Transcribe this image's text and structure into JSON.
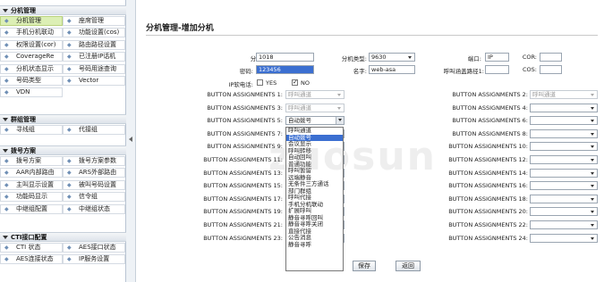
{
  "sidebar": {
    "sections": [
      {
        "title": "分机管理",
        "items": [
          {
            "label": "分机管理",
            "active": true
          },
          {
            "label": "座席管理",
            "active": false
          },
          {
            "label": "手机分机联动",
            "active": false
          },
          {
            "label": "功能设置(cos)",
            "active": false
          },
          {
            "label": "权限设置(cor)",
            "active": false
          },
          {
            "label": "路由路径设置",
            "active": false
          },
          {
            "label": "CoverageRe",
            "active": false
          },
          {
            "label": "已注册IP话机",
            "active": false
          },
          {
            "label": "分机状态显示",
            "active": false
          },
          {
            "label": "号码用途查询",
            "active": false
          },
          {
            "label": "号码类型",
            "active": false
          },
          {
            "label": "Vector",
            "active": false
          },
          {
            "label": "VDN",
            "active": false
          }
        ]
      },
      {
        "title": "群组管理",
        "items": [
          {
            "label": "寻线组",
            "active": false
          },
          {
            "label": "代接组",
            "active": false
          }
        ]
      },
      {
        "title": "拨号方案",
        "items": [
          {
            "label": "拨号方案",
            "active": false
          },
          {
            "label": "拨号方案参数",
            "active": false
          },
          {
            "label": "AAR内部路由",
            "active": false
          },
          {
            "label": "ARS外部路由",
            "active": false
          },
          {
            "label": "主叫显示设置",
            "active": false
          },
          {
            "label": "被叫号码设置",
            "active": false
          },
          {
            "label": "功能码显示",
            "active": false
          },
          {
            "label": "信令组",
            "active": false
          },
          {
            "label": "中继组配置",
            "active": false
          },
          {
            "label": "中继组状态",
            "active": false
          }
        ]
      },
      {
        "title": "CTI接口配置",
        "items": [
          {
            "label": "CTI 状态",
            "active": false
          },
          {
            "label": "AES接口状态",
            "active": false
          },
          {
            "label": "AES连接状态",
            "active": false
          },
          {
            "label": "IP服务设置",
            "active": false
          }
        ]
      }
    ]
  },
  "page": {
    "title": "分机管理-增加分机"
  },
  "form": {
    "ext_no_label": "分机号码:",
    "ext_no_value": "1018",
    "ext_type_label": "分机类型:",
    "ext_type_value": "9630",
    "port_label": "端口:",
    "port_value": "IP",
    "cor_label": "COR:",
    "cor_value": "",
    "password_label": "密码:",
    "password_value": "123456",
    "name_label": "名字:",
    "name_value": "web-asa",
    "cover_path_label": "呼叫涵盖路径1:",
    "cover_path_value": "",
    "cos_label": "COS:",
    "cos_value": "",
    "ip_softphone_label": "IP软电话:",
    "ip_yes_label": "YES",
    "ip_no_label": "NO",
    "ip_yes_checked": false,
    "ip_no_checked": true
  },
  "button_assignments": {
    "left": [
      {
        "label": "BUTTON ASSIGNMENTS 1:",
        "value": "呼叫通道",
        "disabled": true
      },
      {
        "label": "BUTTON ASSIGNMENTS 3:",
        "value": "呼叫通道",
        "disabled": true
      },
      {
        "label": "BUTTON ASSIGNMENTS 5:",
        "value": "自动拨号",
        "disabled": false,
        "open": true
      },
      {
        "label": "BUTTON ASSIGNMENTS 7:",
        "value": "",
        "disabled": false
      },
      {
        "label": "BUTTON ASSIGNMENTS 9:",
        "value": "",
        "disabled": false
      },
      {
        "label": "BUTTON ASSIGNMENTS 11:",
        "value": "",
        "disabled": false
      },
      {
        "label": "BUTTON ASSIGNMENTS 13:",
        "value": "",
        "disabled": false
      },
      {
        "label": "BUTTON ASSIGNMENTS 15:",
        "value": "",
        "disabled": false
      },
      {
        "label": "BUTTON ASSIGNMENTS 17:",
        "value": "",
        "disabled": false
      },
      {
        "label": "BUTTON ASSIGNMENTS 19:",
        "value": "",
        "disabled": false
      },
      {
        "label": "BUTTON ASSIGNMENTS 21:",
        "value": "",
        "disabled": false
      },
      {
        "label": "BUTTON ASSIGNMENTS 23:",
        "value": "",
        "disabled": false
      }
    ],
    "right": [
      {
        "label": "BUTTON ASSIGNMENTS 2:",
        "value": "呼叫通道",
        "disabled": true
      },
      {
        "label": "BUTTON ASSIGNMENTS 4:",
        "value": "",
        "disabled": false
      },
      {
        "label": "BUTTON ASSIGNMENTS 6:",
        "value": "",
        "disabled": false
      },
      {
        "label": "BUTTON ASSIGNMENTS 8:",
        "value": "",
        "disabled": false
      },
      {
        "label": "BUTTON ASSIGNMENTS 10:",
        "value": "",
        "disabled": false
      },
      {
        "label": "BUTTON ASSIGNMENTS 12:",
        "value": "",
        "disabled": false
      },
      {
        "label": "BUTTON ASSIGNMENTS 14:",
        "value": "",
        "disabled": false
      },
      {
        "label": "BUTTON ASSIGNMENTS 16:",
        "value": "",
        "disabled": false
      },
      {
        "label": "BUTTON ASSIGNMENTS 18:",
        "value": "",
        "disabled": false
      },
      {
        "label": "BUTTON ASSIGNMENTS 20:",
        "value": "",
        "disabled": false
      },
      {
        "label": "BUTTON ASSIGNMENTS 22:",
        "value": "",
        "disabled": false
      },
      {
        "label": "BUTTON ASSIGNMENTS 24:",
        "value": "",
        "disabled": false
      }
    ]
  },
  "dropdown_options": [
    "呼叫通道",
    "自动拨号",
    "会议显示",
    "呼叫转移",
    "自动回叫",
    "普通功能",
    "呼叫暂留",
    "远端静音",
    "无条件三方通话",
    "部门群组",
    "呼叫代接",
    "手机分机联动",
    "扩展呼叫",
    "静音寻呼回叫",
    "静音寻呼关闭",
    "直接代接",
    "公告消息",
    "静音寻呼"
  ],
  "dropdown_highlighted": 1,
  "actions": {
    "save_label": "保存",
    "back_label": "返回"
  },
  "watermark": "zuosun"
}
